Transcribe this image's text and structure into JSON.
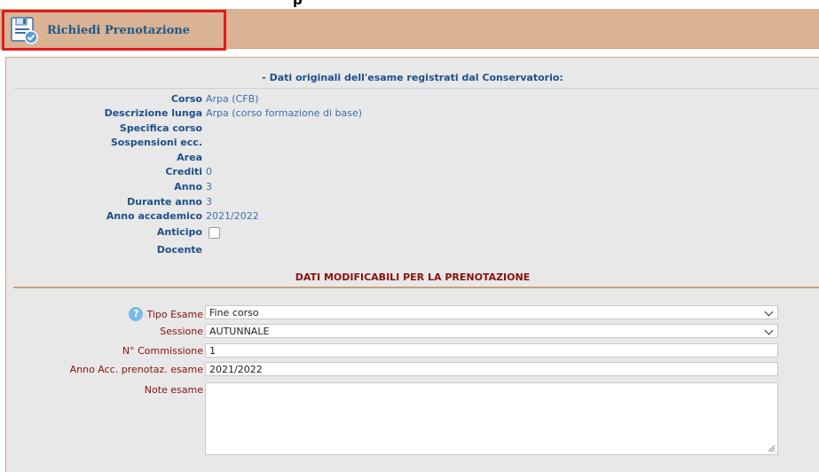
{
  "top_cut_text": "p",
  "toolbar": {
    "button_label": "Richiedi Prenotazione",
    "icon": "save-disk-icon"
  },
  "original": {
    "title": "- Dati originali dell'esame registrati dal Conservatorio:",
    "rows": [
      {
        "label": "Corso",
        "value": "Arpa (CFB)"
      },
      {
        "label": "Descrizione lunga",
        "value": "Arpa (corso formazione di base)"
      },
      {
        "label": "Specifica corso",
        "value": ""
      },
      {
        "label": "Sospensioni ecc.",
        "value": ""
      },
      {
        "label": "Area",
        "value": ""
      },
      {
        "label": "Crediti",
        "value": "0"
      },
      {
        "label": "Anno",
        "value": "3"
      },
      {
        "label": "Durante anno",
        "value": "3"
      },
      {
        "label": "Anno accademico",
        "value": "2021/2022"
      }
    ],
    "anticipo_label": "Anticipo",
    "anticipo_checked": false,
    "docente_label": "Docente",
    "docente_value": ""
  },
  "editable": {
    "title": "DATI MODIFICABILI PER LA PRENOTAZIONE",
    "tipo_esame": {
      "label": "Tipo Esame",
      "value": "Fine corso"
    },
    "sessione": {
      "label": "Sessione",
      "value": "AUTUNNALE"
    },
    "commissione": {
      "label": "N° Commissione",
      "value": "1"
    },
    "anno_acc": {
      "label": "Anno Acc. prenotaz. esame",
      "value": "2021/2022"
    },
    "note": {
      "label": "Note esame",
      "value": ""
    }
  },
  "colors": {
    "toolbar": "#d9b394",
    "highlight": "#e31a1a",
    "label_blue": "#1e4f8a",
    "label_red": "#8a1010"
  }
}
